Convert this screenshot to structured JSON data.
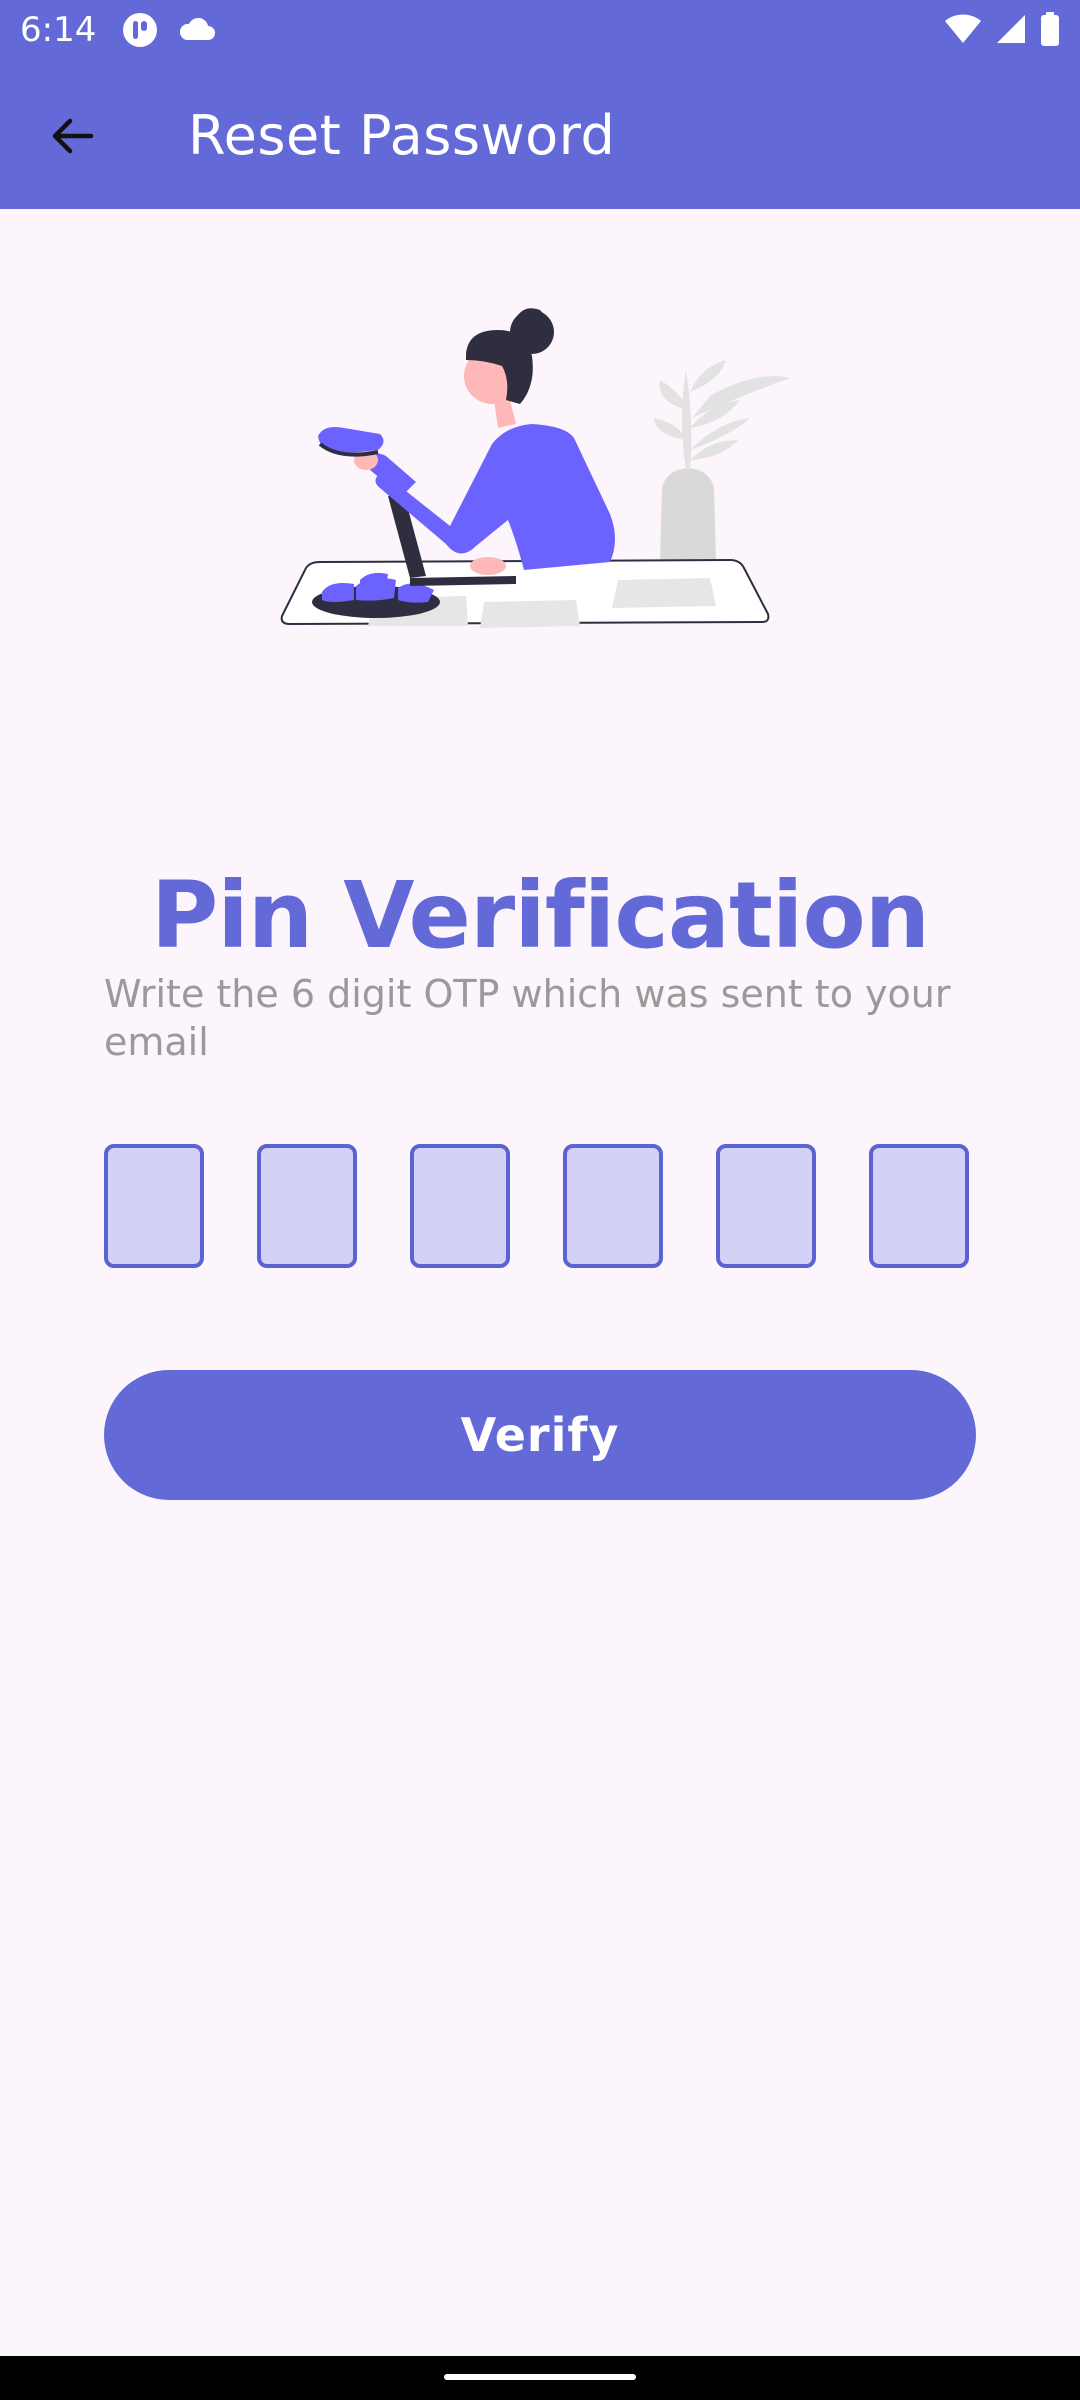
{
  "status_bar": {
    "time": "6:14",
    "left_icons": [
      "app-notification-icon",
      "cloud-icon"
    ],
    "right_icons": [
      "wifi-icon",
      "cell-signal-icon",
      "battery-icon"
    ]
  },
  "toolbar": {
    "back_icon": "arrow-left-icon",
    "title": "Reset Password"
  },
  "main": {
    "illustration": "person-at-desk-illustration",
    "title": "Pin Verification",
    "subtitle": "Write the 6 digit OTP which was sent to your email",
    "otp_boxes": [
      "",
      "",
      "",
      "",
      "",
      ""
    ],
    "verify_label": "Verify"
  },
  "colors": {
    "primary": "#636AD8",
    "background": "#FCF5FC",
    "otp_fill": "#D3D2F6",
    "otp_border": "#5C62D2",
    "subtitle_text": "#9A9A9A"
  }
}
